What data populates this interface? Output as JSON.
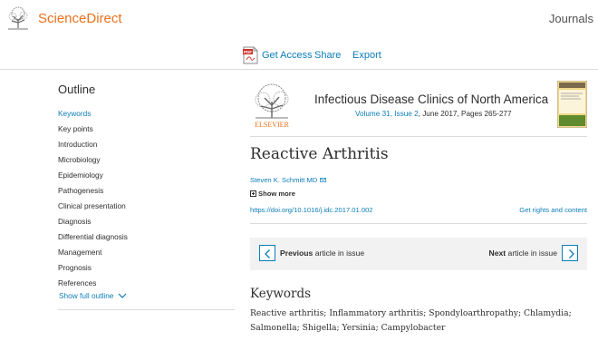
{
  "header": {
    "brand": "ScienceDirect",
    "journals_link": "Journals",
    "logo_icon": "elsevier-tree-logo-icon",
    "brand_color": "#e9711c"
  },
  "actions": {
    "get_access": "Get Access",
    "share": "Share",
    "export": "Export",
    "pdf_icon": "pdf-icon",
    "link_color": "#0c7dbb"
  },
  "outline": {
    "title": "Outline",
    "items": [
      {
        "label": "Keywords",
        "active": true
      },
      {
        "label": "Key points",
        "active": false
      },
      {
        "label": "Introduction",
        "active": false
      },
      {
        "label": "Microbiology",
        "active": false
      },
      {
        "label": "Epidemiology",
        "active": false
      },
      {
        "label": "Pathogenesis",
        "active": false
      },
      {
        "label": "Clinical presentation",
        "active": false
      },
      {
        "label": "Diagnosis",
        "active": false
      },
      {
        "label": "Differential diagnosis",
        "active": false
      },
      {
        "label": "Management",
        "active": false
      },
      {
        "label": "Prognosis",
        "active": false
      },
      {
        "label": "References",
        "active": false
      }
    ],
    "show_full": "Show full outline"
  },
  "journal": {
    "publisher": "ELSEVIER",
    "title": "Infectious Disease Clinics of North America",
    "volume": "Volume 31, Issue 2",
    "date_pages": ", June 2017, Pages 265-277"
  },
  "article": {
    "title": "Reactive Arthritis",
    "author": "Steven K. Schmitt MD",
    "show_more": "Show more",
    "doi": "https://doi.org/10.1016/j.idc.2017.01.002",
    "rights": "Get rights and content"
  },
  "issue_nav": {
    "prev_bold": "Previous",
    "prev_rest": " article in issue",
    "next_bold": "Next",
    "next_rest": " article in issue"
  },
  "keywords": {
    "title": "Keywords",
    "line1": "Reactive arthritis; Inflammatory arthritis; Spondyloarthropathy; Chlamydia;",
    "line2": "Salmonella; Shigella; Yersinia; Campylobacter"
  }
}
